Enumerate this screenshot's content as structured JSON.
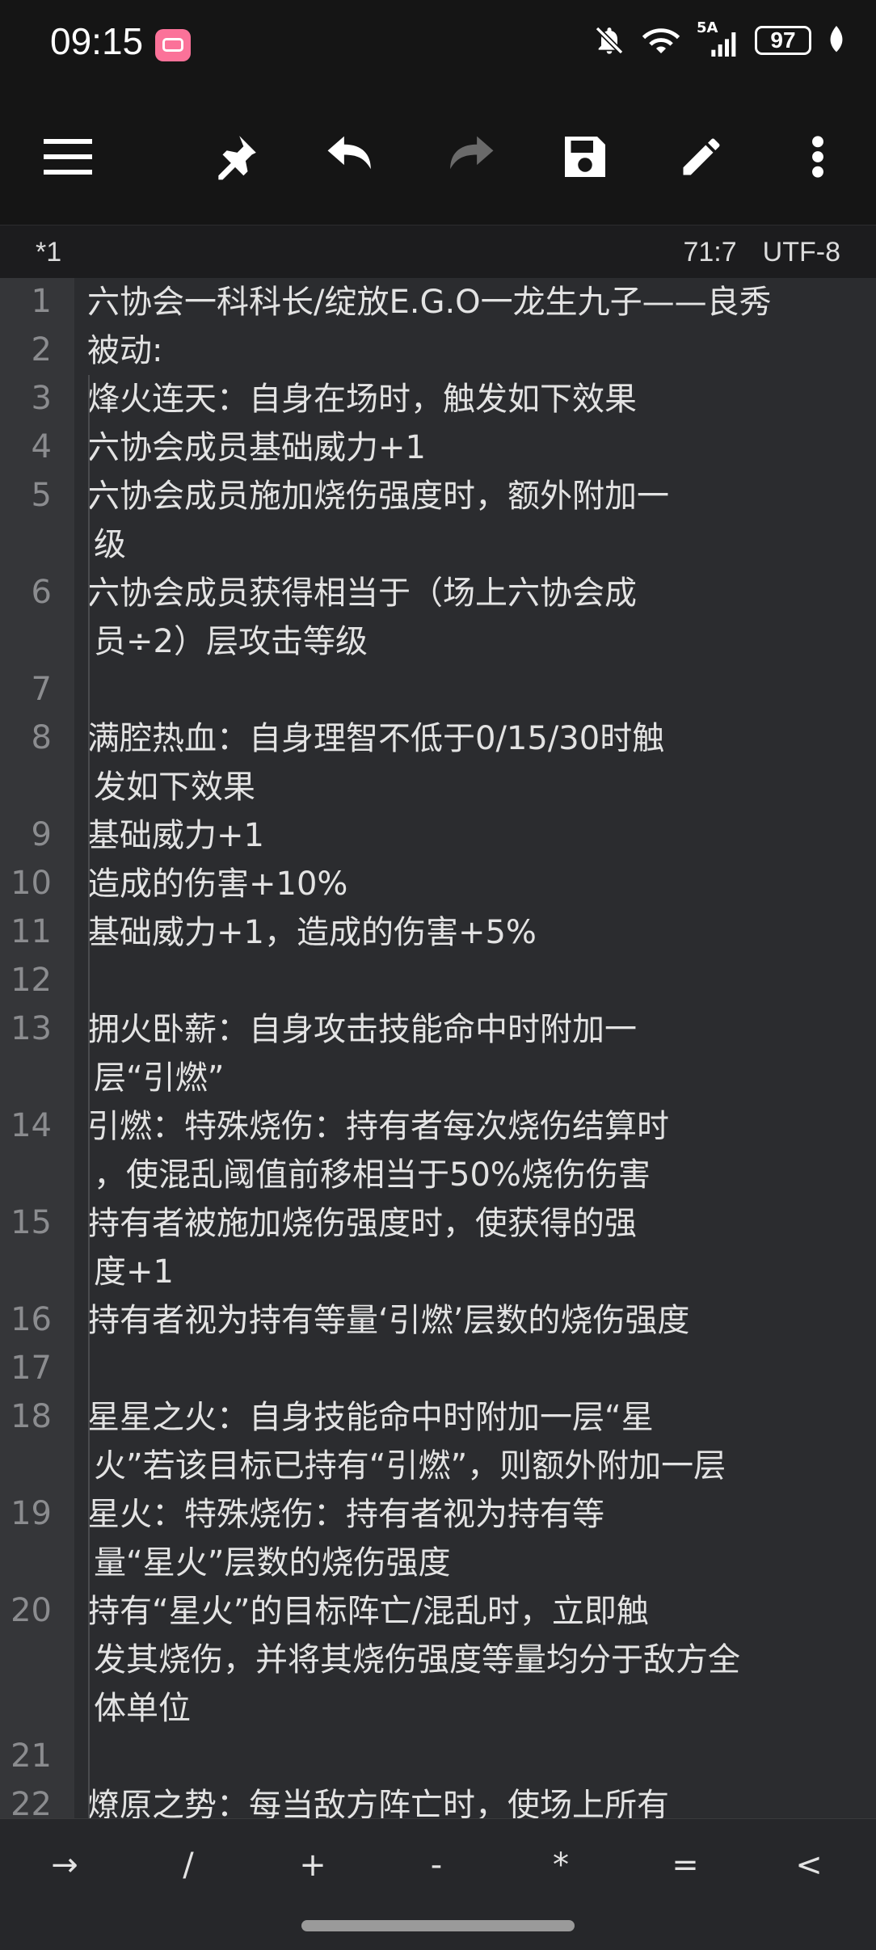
{
  "status_bar": {
    "time": "09:15",
    "app_icon": "bilibili-icon",
    "network_label": "5A",
    "battery": "97",
    "icons": [
      "bell-off-icon",
      "wifi-icon",
      "signal-icon",
      "battery-icon",
      "leaf-icon"
    ]
  },
  "toolbar": {
    "icons": [
      "menu-icon",
      "pin-icon",
      "undo-icon",
      "redo-icon",
      "save-icon",
      "edit-icon",
      "more-icon"
    ]
  },
  "info_bar": {
    "file_name": "*1",
    "cursor_position": "71:7",
    "encoding": "UTF-8"
  },
  "editor": {
    "lines": [
      {
        "n": "1",
        "rows": [
          "六协会一科科长/绽放E.G.O一龙生九子——良秀"
        ]
      },
      {
        "n": "2",
        "rows": [
          "被动:"
        ]
      },
      {
        "n": "3",
        "rows": [
          "      烽火连天：自身在场时，触发如下效果"
        ]
      },
      {
        "n": "4",
        "rows": [
          "      六协会成员基础威力+1"
        ]
      },
      {
        "n": "5",
        "rows": [
          "      六协会成员施加烧伤强度时，额外附加一",
          "级"
        ]
      },
      {
        "n": "6",
        "rows": [
          "      六协会成员获得相当于（场上六协会成",
          "员÷2）层攻击等级"
        ]
      },
      {
        "n": "7",
        "rows": [
          ""
        ]
      },
      {
        "n": "8",
        "rows": [
          "      满腔热血：自身理智不低于0/15/30时触",
          "发如下效果"
        ]
      },
      {
        "n": "9",
        "rows": [
          "      基础威力+1"
        ]
      },
      {
        "n": "10",
        "rows": [
          "      造成的伤害+10%"
        ]
      },
      {
        "n": "11",
        "rows": [
          "      基础威力+1，造成的伤害+5%"
        ]
      },
      {
        "n": "12",
        "rows": [
          ""
        ]
      },
      {
        "n": "13",
        "rows": [
          "      拥火卧薪：自身攻击技能命中时附加一",
          "层“引燃”"
        ]
      },
      {
        "n": "14",
        "rows": [
          "      引燃：特殊烧伤：持有者每次烧伤结算时",
          "，使混乱阈值前移相当于50%烧伤伤害"
        ]
      },
      {
        "n": "15",
        "rows": [
          "      持有者被施加烧伤强度时，使获得的强",
          "度+1"
        ]
      },
      {
        "n": "16",
        "rows": [
          "      持有者视为持有等量‘引燃’层数的烧伤强度"
        ]
      },
      {
        "n": "17",
        "rows": [
          ""
        ]
      },
      {
        "n": "18",
        "rows": [
          "      星星之火：自身技能命中时附加一层“星",
          "火”若该目标已持有“引燃”，则额外附加一层"
        ]
      },
      {
        "n": "19",
        "rows": [
          "      星火：特殊烧伤：持有者视为持有等",
          "量“星火”层数的烧伤强度"
        ]
      },
      {
        "n": "20",
        "rows": [
          "      持有“星火”的目标阵亡/混乱时，立即触",
          "发其烧伤，并将其烧伤强度等量均分于敌方全",
          "体单位"
        ]
      },
      {
        "n": "21",
        "rows": [
          ""
        ]
      },
      {
        "n": "22",
        "rows": [
          "      燎原之势：每当敌方阵亡时，使场上所有"
        ]
      }
    ]
  },
  "symbol_bar": {
    "keys": [
      "→",
      "/",
      "+",
      "-",
      "*",
      "=",
      "<"
    ]
  }
}
